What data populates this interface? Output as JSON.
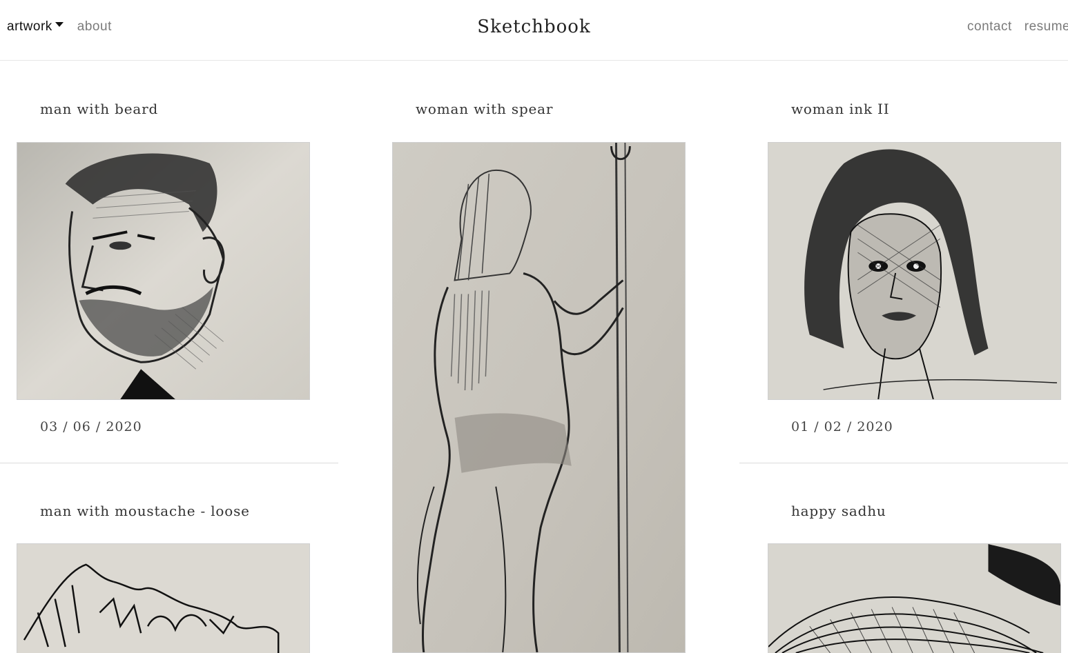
{
  "nav": {
    "artwork_label": "artwork",
    "about_label": "about",
    "brand": "Sketchbook",
    "contact_label": "contact",
    "resume_label": "resume"
  },
  "cards": [
    {
      "title": "man with beard",
      "date": "03 / 06 / 2020"
    },
    {
      "title": "woman with spear",
      "date": ""
    },
    {
      "title": "woman ink II",
      "date": "01 / 02 / 2020"
    },
    {
      "title": "man with moustache - loose",
      "date": ""
    },
    {
      "title": "happy sadhu",
      "date": ""
    }
  ],
  "colors": {
    "paper": "#dcd9d2",
    "ink": "#1a1a1a",
    "divider": "#dcdcdc"
  }
}
